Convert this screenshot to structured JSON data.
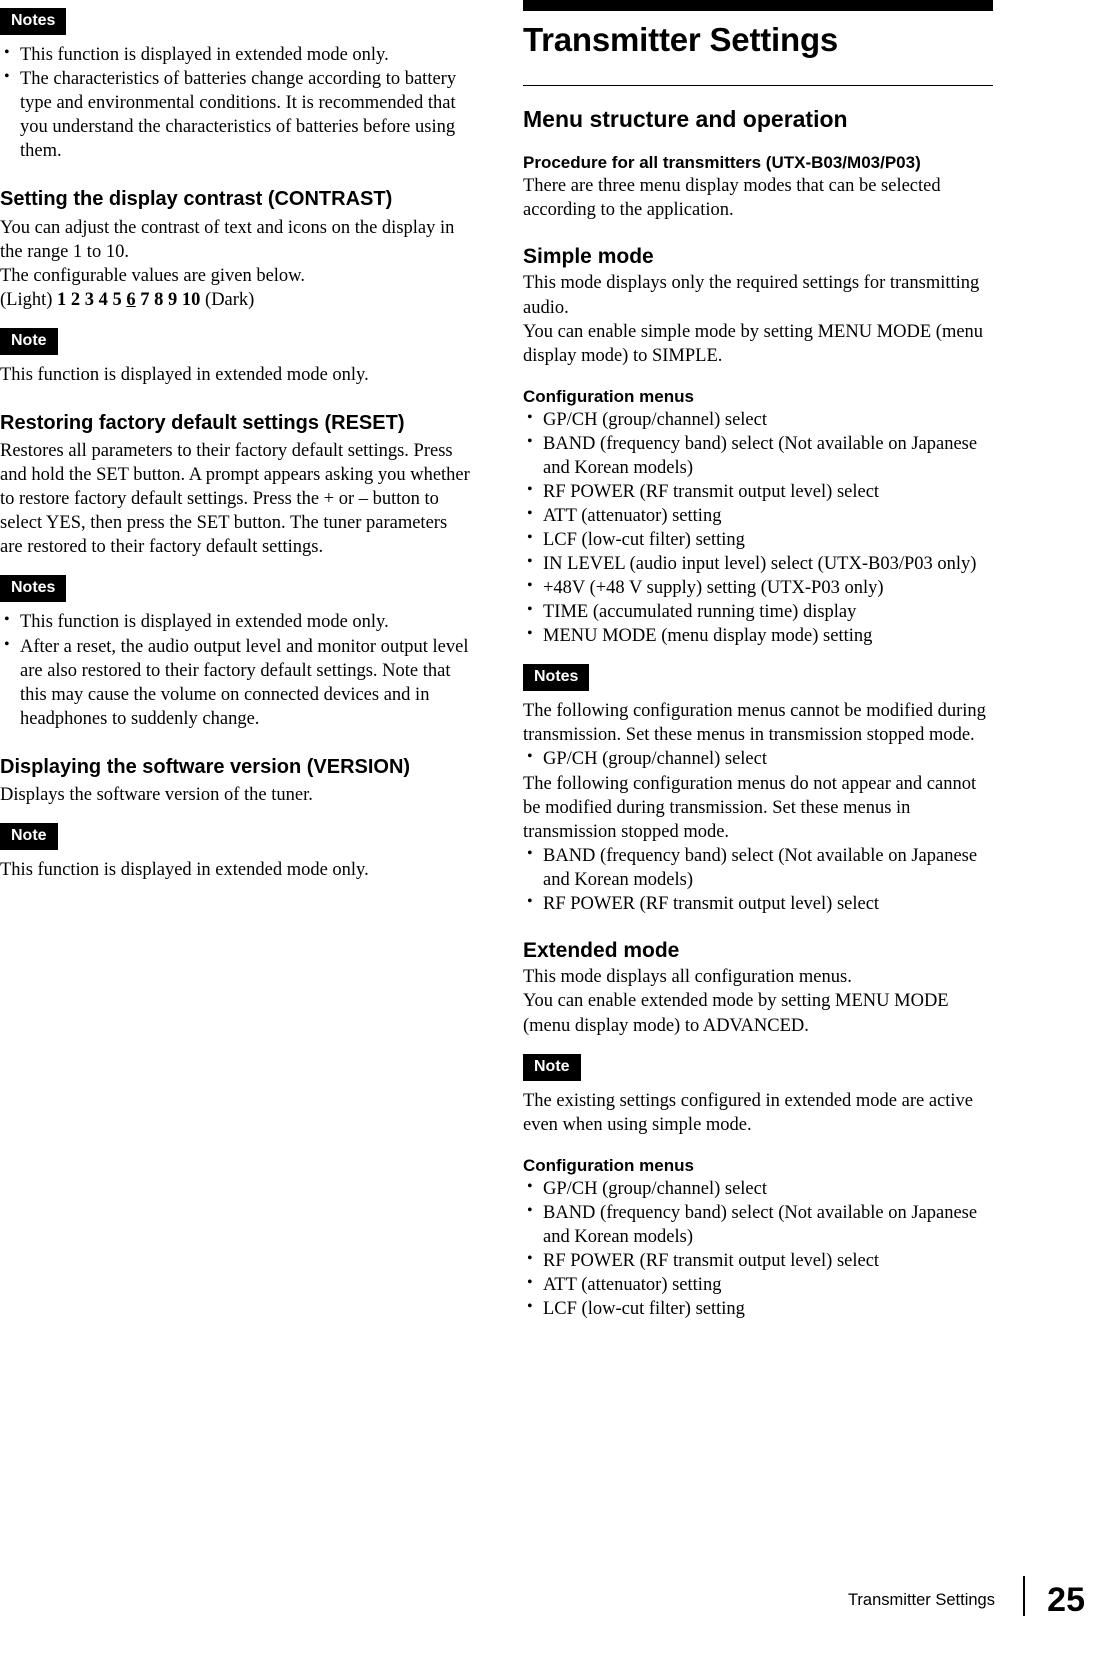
{
  "left_column": {
    "notes_badge_1": "Notes",
    "notes_1": [
      "This function is displayed in extended mode only.",
      "The characteristics of batteries change according to battery type and environmental conditions. It is recommended that you understand the characteristics of batteries before using them."
    ],
    "heading_contrast": "Setting the display contrast (CONTRAST)",
    "contrast_body_1": "You can adjust the contrast of text and icons on the display in the range 1 to 10.",
    "contrast_body_2": "The configurable values are given below.",
    "contrast_values_prefix": "(Light) ",
    "contrast_values_list": "1 2 3 4 5 ",
    "contrast_values_selected": "6",
    "contrast_values_rest": " 7 8 9 10",
    "contrast_values_suffix": " (Dark)",
    "note_badge_1": "Note",
    "note_1_text": "This function is displayed in extended mode only.",
    "heading_reset": "Restoring factory default settings (RESET)",
    "reset_body": "Restores all parameters to their factory default settings. Press and hold the SET button. A prompt appears asking you whether to restore factory default settings. Press the + or – button to select YES, then press the SET button. The tuner parameters are restored to their factory default settings.",
    "notes_badge_2": "Notes",
    "notes_2": [
      "This function is displayed in extended mode only.",
      "After a reset, the audio output level and monitor output level are also restored to their factory default settings. Note that this may cause the volume on connected devices and in headphones to suddenly change."
    ],
    "heading_version": "Displaying the software version (VERSION)",
    "version_body": "Displays the software version of the tuner.",
    "note_badge_2": "Note",
    "note_2_text": "This function is displayed in extended mode only."
  },
  "right_column": {
    "chapter_title": "Transmitter Settings",
    "section_title": "Menu structure and operation",
    "procedure_heading": "Procedure for all transmitters (UTX-B03/M03/P03)",
    "procedure_body": "There are three menu display modes that can be selected according to the application.",
    "simple_heading": "Simple mode",
    "simple_body_1": "This mode displays only the required settings for transmitting audio.",
    "simple_body_2": "You can enable simple mode by setting MENU MODE (menu display mode) to SIMPLE.",
    "config_heading_1": "Configuration menus",
    "config_menus_1": [
      "GP/CH (group/channel) select",
      "BAND (frequency band) select (Not available on Japanese and Korean models)",
      "RF POWER (RF transmit output level) select",
      "ATT (attenuator) setting",
      "LCF (low-cut filter) setting",
      "IN LEVEL (audio input level) select (UTX-B03/P03 only)",
      "+48V (+48 V supply) setting (UTX-P03 only)",
      "TIME (accumulated running time) display",
      "MENU MODE (menu display mode) setting"
    ],
    "notes_badge_1": "Notes",
    "notes_body_1": "The following configuration menus cannot be modified during transmission. Set these menus in transmission stopped mode.",
    "notes_bullets_1": [
      "GP/CH (group/channel) select"
    ],
    "notes_body_2": "The following configuration menus do not appear and cannot be modified during transmission. Set these menus in transmission stopped mode.",
    "notes_bullets_2": [
      "BAND (frequency band) select (Not available on Japanese and Korean models)",
      "RF POWER (RF transmit output level) select"
    ],
    "extended_heading": "Extended mode",
    "extended_body_1": "This mode displays all configuration menus.",
    "extended_body_2": "You can enable extended mode by setting MENU MODE (menu display mode) to ADVANCED.",
    "note_badge_1": "Note",
    "note_body_1": "The existing settings configured in extended mode are active even when using simple mode.",
    "config_heading_2": "Configuration menus",
    "config_menus_2": [
      "GP/CH (group/channel) select",
      "BAND (frequency band) select (Not available on Japanese and Korean models)",
      "RF POWER (RF transmit output level) select",
      "ATT (attenuator) setting",
      "LCF (low-cut filter) setting"
    ]
  },
  "footer": {
    "label": "Transmitter Settings",
    "page_number": "25"
  }
}
